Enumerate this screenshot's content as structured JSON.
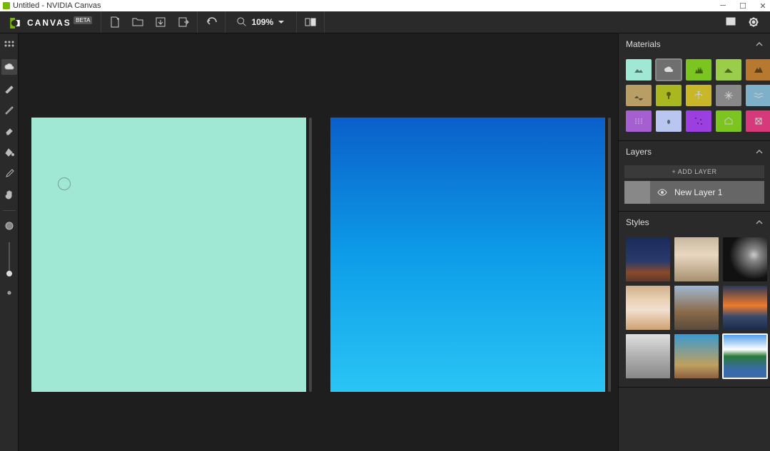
{
  "window": {
    "title": "Untitled - NVIDIA Canvas"
  },
  "header": {
    "app_name": "CANVAS",
    "beta": "BETA",
    "zoom": "109%"
  },
  "tools": [
    {
      "name": "move-tool-icon"
    },
    {
      "name": "cloud-tool-icon",
      "active": true
    },
    {
      "name": "brush-tool-icon"
    },
    {
      "name": "pencil-tool-icon"
    },
    {
      "name": "eraser-tool-icon"
    },
    {
      "name": "fill-tool-icon"
    },
    {
      "name": "eyedropper-tool-icon"
    },
    {
      "name": "pan-tool-icon"
    }
  ],
  "panels": {
    "materials": {
      "title": "Materials",
      "items": [
        {
          "color": "#a0e8d4",
          "icon": "landscape"
        },
        {
          "color": "#6f6f6f",
          "icon": "cloud",
          "selected": true
        },
        {
          "color": "#7cc41f",
          "icon": "grass"
        },
        {
          "color": "#9acd4a",
          "icon": "hill"
        },
        {
          "color": "#b6792f",
          "icon": "mountain"
        },
        {
          "color": "#b89d65",
          "icon": "dune"
        },
        {
          "color": "#aab820",
          "icon": "tree"
        },
        {
          "color": "#c9b72a",
          "icon": "palm"
        },
        {
          "color": "#888888",
          "icon": "snow"
        },
        {
          "color": "#7fb0c9",
          "icon": "waves"
        },
        {
          "color": "#a65fd0",
          "icon": "fog"
        },
        {
          "color": "#b8c6f0",
          "icon": "rain"
        },
        {
          "color": "#9b3fe0",
          "icon": "stars"
        },
        {
          "color": "#7cc41f",
          "icon": "house"
        },
        {
          "color": "#d63a7a",
          "icon": "structure"
        }
      ]
    },
    "layers": {
      "title": "Layers",
      "add_label": "+ ADD LAYER",
      "items": [
        {
          "name": "New Layer 1"
        }
      ]
    },
    "styles": {
      "title": "Styles",
      "items": [
        {
          "bg": "linear-gradient(180deg,#1b2a5a 0%,#2a3a6a 55%,#8a4a2a 80%,#5a3a2a 100%)"
        },
        {
          "bg": "linear-gradient(180deg,#c8b8a0 0%,#e8d8c0 40%,#a89070 100%)"
        },
        {
          "bg": "radial-gradient(circle at 70% 40%,#ccc 0%,#888 15%,#111 60%)"
        },
        {
          "bg": "linear-gradient(180deg,#d0b090 0%,#e8d0b0 30%,#f0e0d0 55%,#d0a070 100%)"
        },
        {
          "bg": "linear-gradient(180deg,#a0b8d0 0%,#8a6a4a 60%,#5a4a3a 100%)"
        },
        {
          "bg": "linear-gradient(180deg,#2a3a5a 0%,#f07a2a 45%,#3a4a6a 70%,#1a2a4a 100%)"
        },
        {
          "bg": "linear-gradient(180deg,#e0e0e0 0%,#b0b0b0 50%,#888 100%)"
        },
        {
          "bg": "linear-gradient(180deg,#3a9ad0 0%,#c0a060 70%,#8a6040 100%)"
        },
        {
          "bg": "linear-gradient(180deg,#4a9aea 0%,#fff 35%,#2a7a3a 50%,#3a6aaa 80%)",
          "selected": true
        }
      ]
    }
  }
}
